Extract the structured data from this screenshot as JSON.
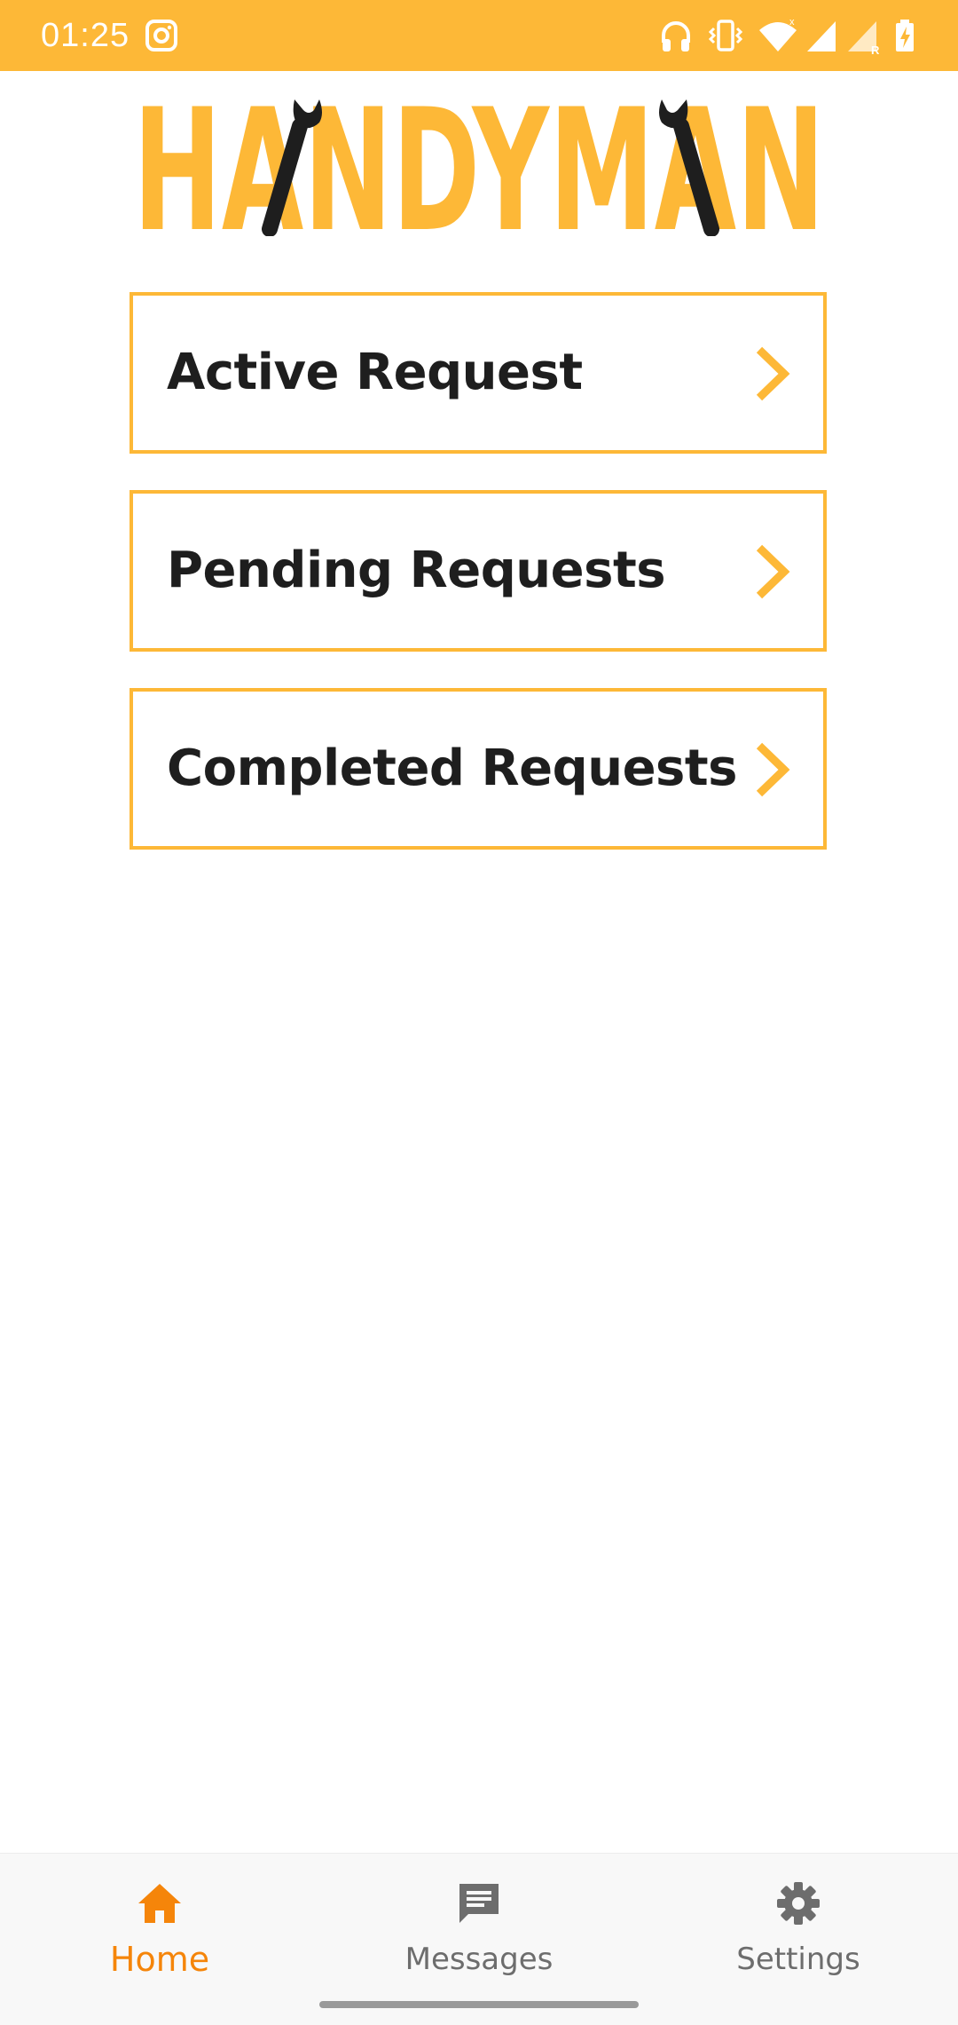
{
  "status_bar": {
    "time": "01:25",
    "icons": [
      "instagram-icon",
      "headphones-icon",
      "vibrate-icon",
      "wifi-icon",
      "signal-icon",
      "signal-roaming-icon",
      "battery-charging-icon"
    ],
    "background_color": "#FDB837"
  },
  "logo": {
    "text": "HANDYMAN",
    "brand_color": "#FDB837",
    "accent_color": "#1e1e1e"
  },
  "requests": [
    {
      "label": "Active Request",
      "icon": "chevron-right-icon"
    },
    {
      "label": "Pending Requests",
      "icon": "chevron-right-icon"
    },
    {
      "label": "Completed Requests",
      "icon": "chevron-right-icon"
    }
  ],
  "bottom_nav": {
    "items": [
      {
        "label": "Home",
        "icon": "home-icon",
        "active": true
      },
      {
        "label": "Messages",
        "icon": "message-icon",
        "active": false
      },
      {
        "label": "Settings",
        "icon": "gear-icon",
        "active": false
      }
    ],
    "active_color": "#F5850A",
    "inactive_color": "#6d6d6d"
  }
}
